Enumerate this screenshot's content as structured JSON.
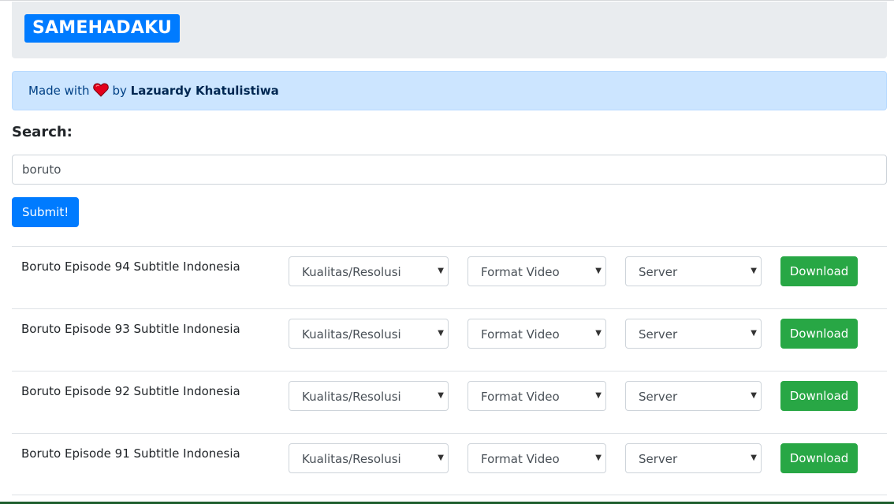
{
  "brand": {
    "label": "SAMEHADAKU"
  },
  "banner": {
    "made_with": "Made with",
    "by": "by",
    "author": "Lazuardy Khatulistiwa",
    "heart_color": "#e3001b"
  },
  "search": {
    "label": "Search:",
    "value": "boruto",
    "submit_label": "Submit!"
  },
  "results": [
    {
      "title": "Boruto Episode 94 Subtitle Indonesia",
      "quality": "Kualitas/Resolusi",
      "format": "Format Video",
      "server": "Server",
      "download_label": "Download"
    },
    {
      "title": "Boruto Episode 93 Subtitle Indonesia",
      "quality": "Kualitas/Resolusi",
      "format": "Format Video",
      "server": "Server",
      "download_label": "Download"
    },
    {
      "title": "Boruto Episode 92 Subtitle Indonesia",
      "quality": "Kualitas/Resolusi",
      "format": "Format Video",
      "server": "Server",
      "download_label": "Download"
    },
    {
      "title": "Boruto Episode 91 Subtitle Indonesia",
      "quality": "Kualitas/Resolusi",
      "format": "Format Video",
      "server": "Server",
      "download_label": "Download"
    }
  ],
  "colors": {
    "primary": "#007bff",
    "success": "#28a745",
    "alert_bg": "#cce5ff",
    "jumbotron_bg": "#e9ecef"
  }
}
